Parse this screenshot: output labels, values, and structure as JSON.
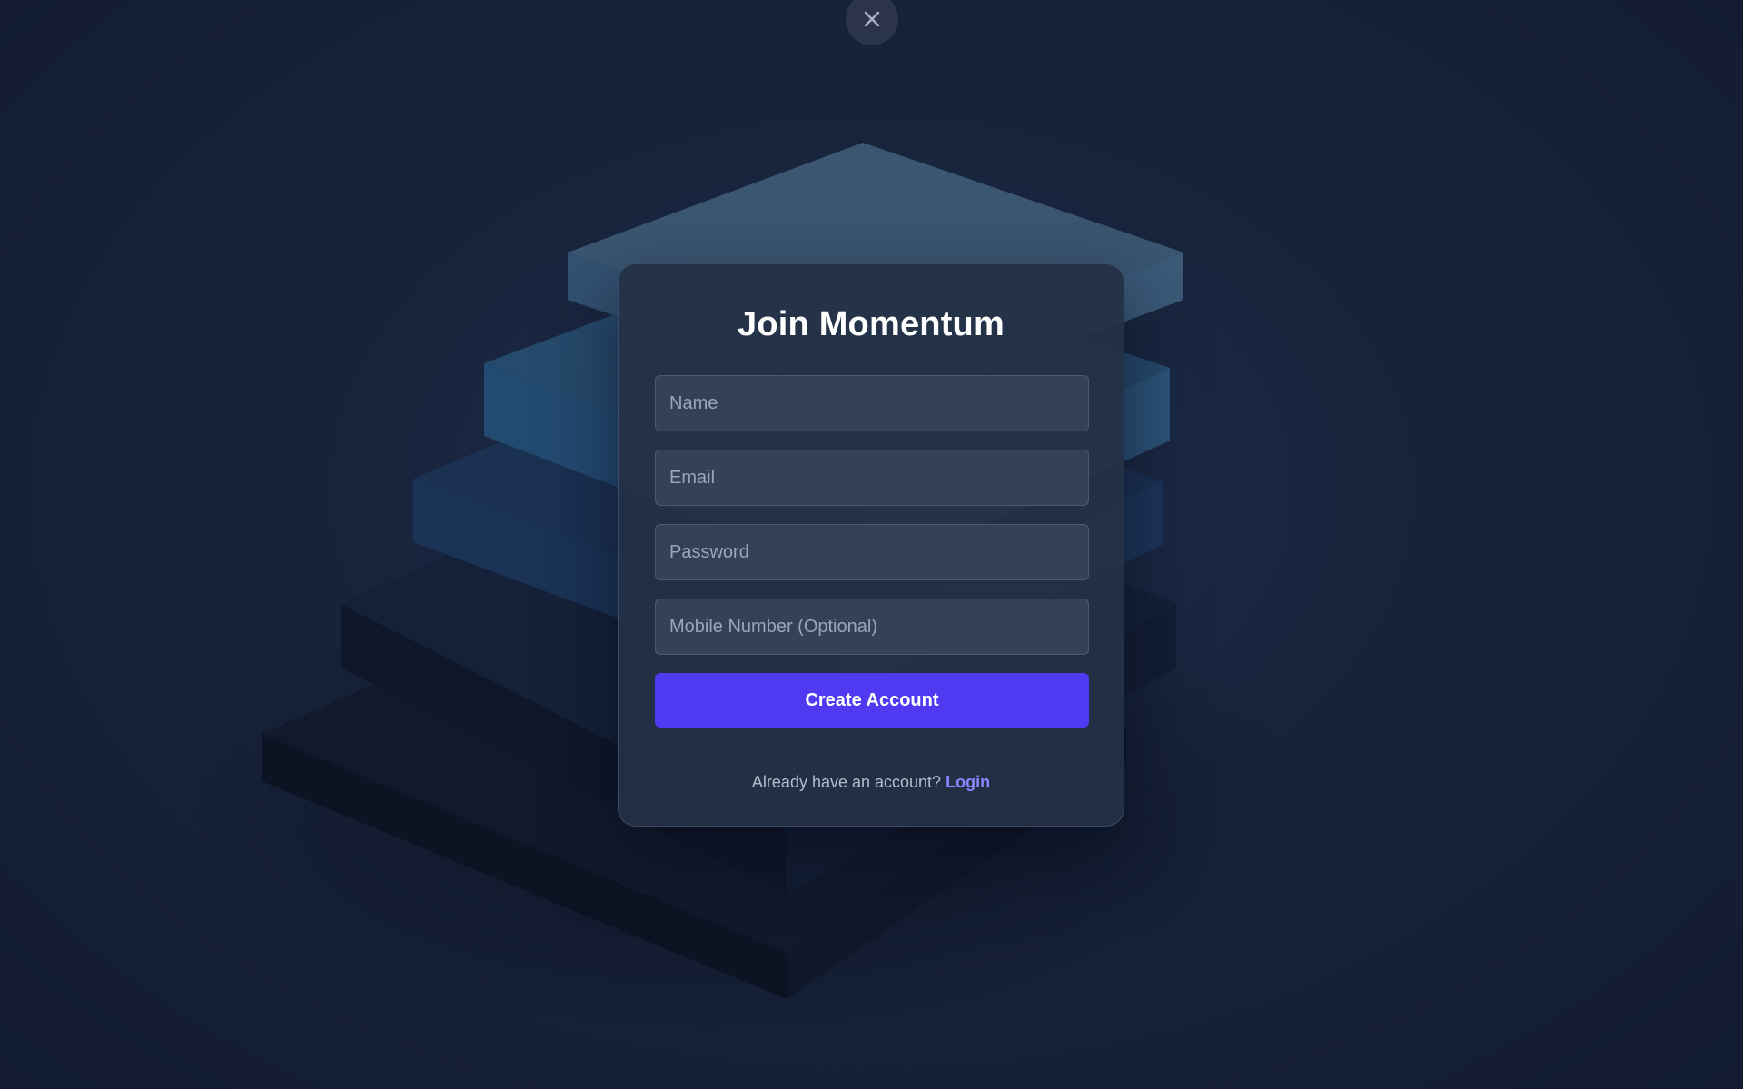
{
  "modal": {
    "close_icon": "close-icon",
    "title": "Join Momentum",
    "fields": {
      "name": {
        "placeholder": "Name",
        "value": ""
      },
      "email": {
        "placeholder": "Email",
        "value": ""
      },
      "password": {
        "placeholder": "Password",
        "value": ""
      },
      "mobile": {
        "placeholder": "Mobile Number (Optional)",
        "value": ""
      }
    },
    "submit_label": "Create Account",
    "footer_text": "Already have an account?",
    "login_link": "Login"
  },
  "colors": {
    "background": "#18233b",
    "card": "#243046",
    "input": "#334259",
    "accent": "#4f3af2",
    "link": "#8b86ff"
  }
}
